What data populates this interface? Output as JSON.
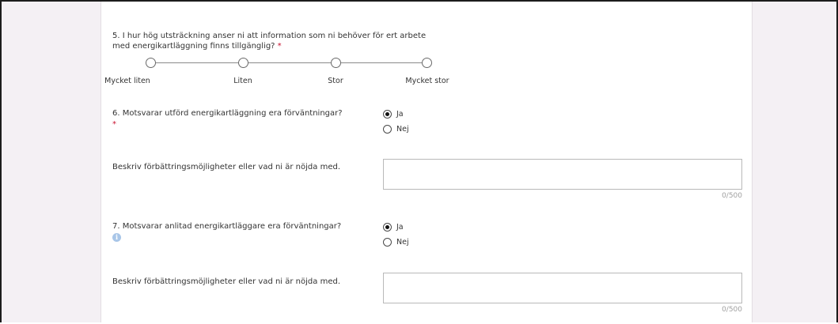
{
  "q5": {
    "text_line1": "5. I hur hög utsträckning anser ni att information som ni behöver för ert arbete",
    "text_line2": "med energikartläggning finns tillgänglig?",
    "required": "*",
    "scale": [
      "Mycket liten",
      "Liten",
      "Stor",
      "Mycket stor"
    ]
  },
  "q6": {
    "text": "6. Motsvarar utförd energikartläggning era förväntningar?",
    "required": "*",
    "options": [
      "Ja",
      "Nej"
    ],
    "selected": "Ja",
    "comment_label": "Beskriv förbättringsmöjligheter eller vad ni är nöjda med.",
    "comment_value": "",
    "counter": "0/500"
  },
  "q7": {
    "text": "7. Motsvarar anlitad energikartläggare era förväntningar?",
    "info_icon": "info-icon",
    "options": [
      "Ja",
      "Nej"
    ],
    "selected": "Ja",
    "comment_label": "Beskriv förbättringsmöjligheter eller vad ni är nöjda med.",
    "comment_value": "",
    "counter": "0/500"
  },
  "colors": {
    "required": "#c8102e",
    "info": "#a9c6e8",
    "page_background": "#f4f0f4"
  }
}
